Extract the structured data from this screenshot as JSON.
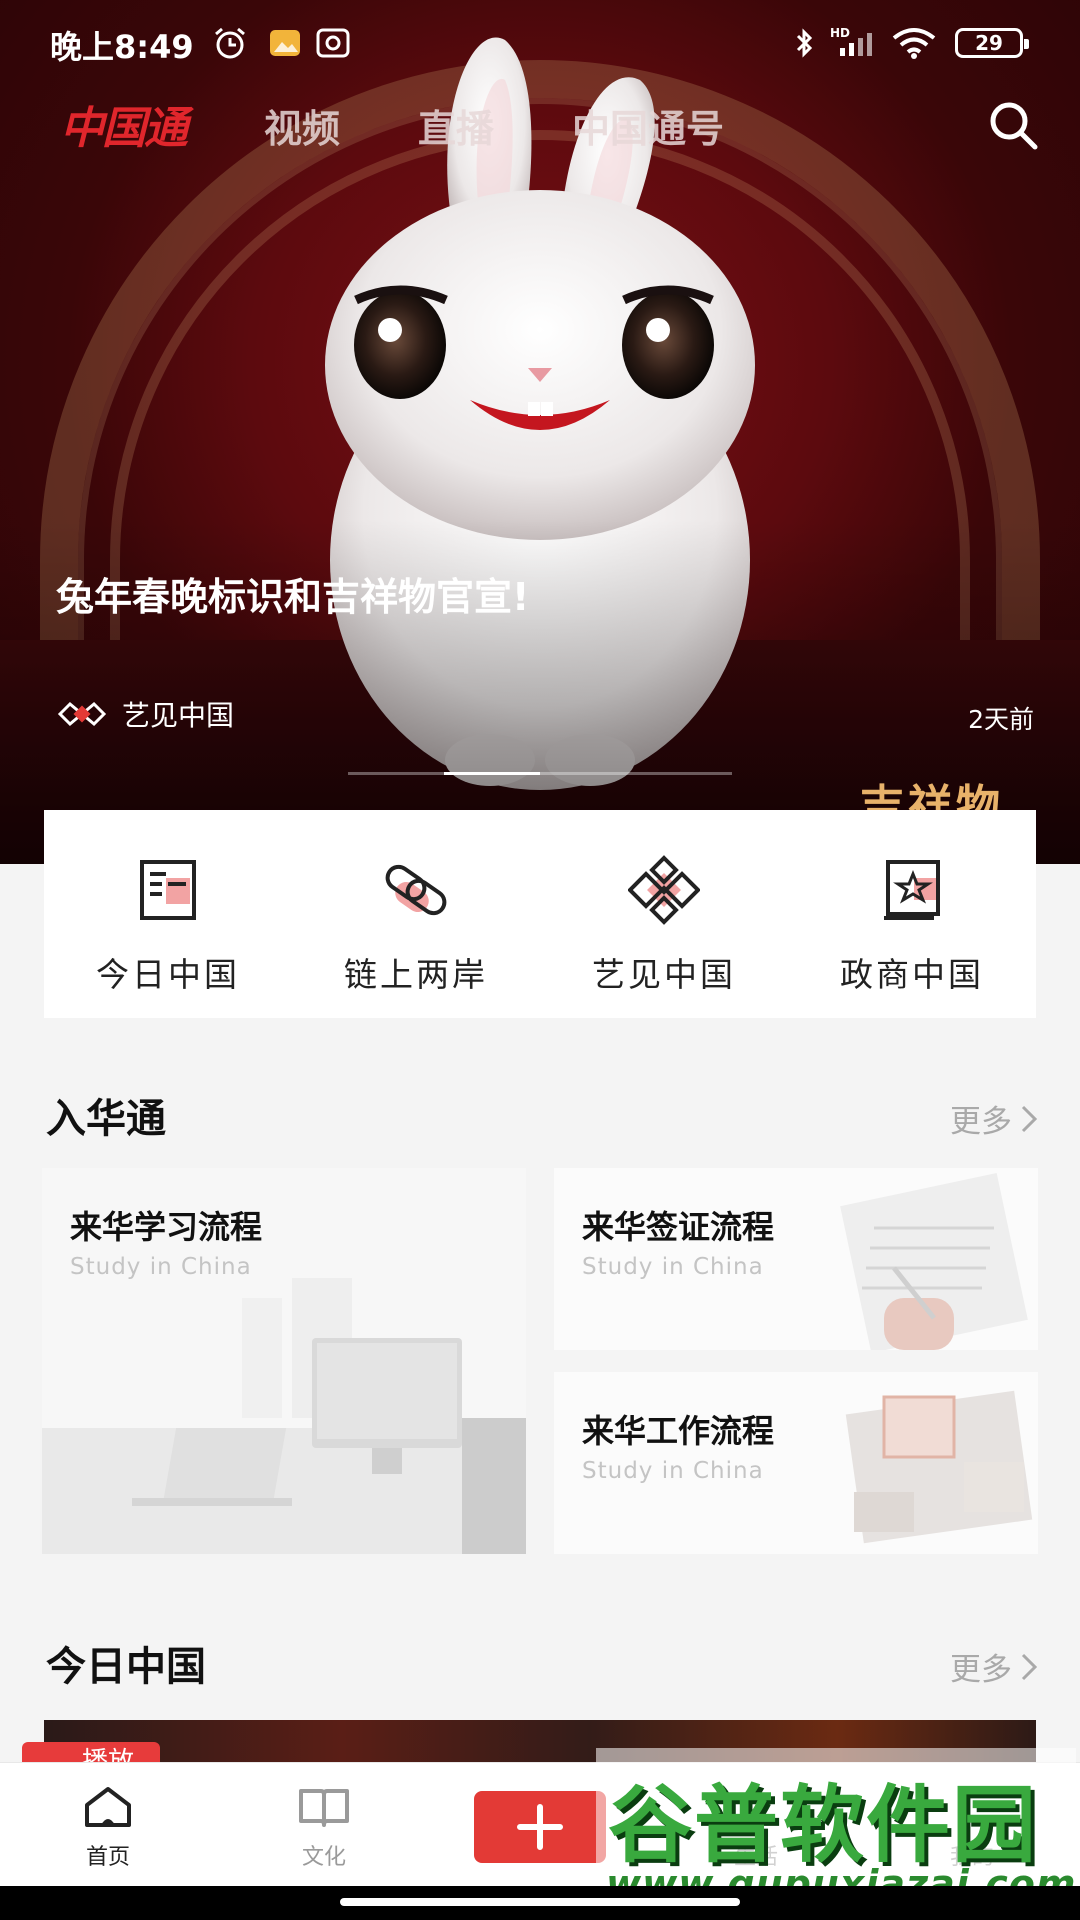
{
  "status": {
    "time": "晚上8:49",
    "network": "HD",
    "battery": "29"
  },
  "topnav": {
    "logo": "中国通",
    "tabs": [
      "视频",
      "直播",
      "中国通号"
    ]
  },
  "hero": {
    "title": "兔年春晚标识和吉祥物官宣!",
    "source": "艺见中国",
    "time": "2天前",
    "stamp": "吉祥物",
    "slide_count": 4,
    "active_slide": 1
  },
  "categories": [
    {
      "label": "今日中国",
      "icon": "newspaper-icon"
    },
    {
      "label": "链上两岸",
      "icon": "link-icon"
    },
    {
      "label": "艺见中国",
      "icon": "diamond-knot-icon"
    },
    {
      "label": "政商中国",
      "icon": "star-badge-icon"
    }
  ],
  "section_huatong": {
    "title": "入华通",
    "more": "更多",
    "cards": [
      {
        "title": "来华学习流程",
        "subtitle": "Study in China"
      },
      {
        "title": "来华签证流程",
        "subtitle": "Study in China"
      },
      {
        "title": "来华工作流程",
        "subtitle": "Study in China"
      }
    ]
  },
  "section_today": {
    "title": "今日中国",
    "more": "更多",
    "live_tag": "播放"
  },
  "bottomnav": {
    "items": [
      {
        "label": "首页",
        "icon": "home-icon",
        "active": true
      },
      {
        "label": "文化",
        "icon": "book-icon",
        "active": false
      },
      {
        "label": "生活",
        "icon": "life-icon",
        "active": false
      },
      {
        "label": "我的",
        "icon": "profile-icon",
        "active": false
      }
    ],
    "add_icon": "plus-icon"
  },
  "watermark": {
    "line1": "谷普软件园",
    "line2": "www.gupuxiazai.com"
  },
  "colors": {
    "accent": "#e33a36",
    "hero_bg": "#5c0a0e",
    "muted": "#a9a9a9"
  }
}
